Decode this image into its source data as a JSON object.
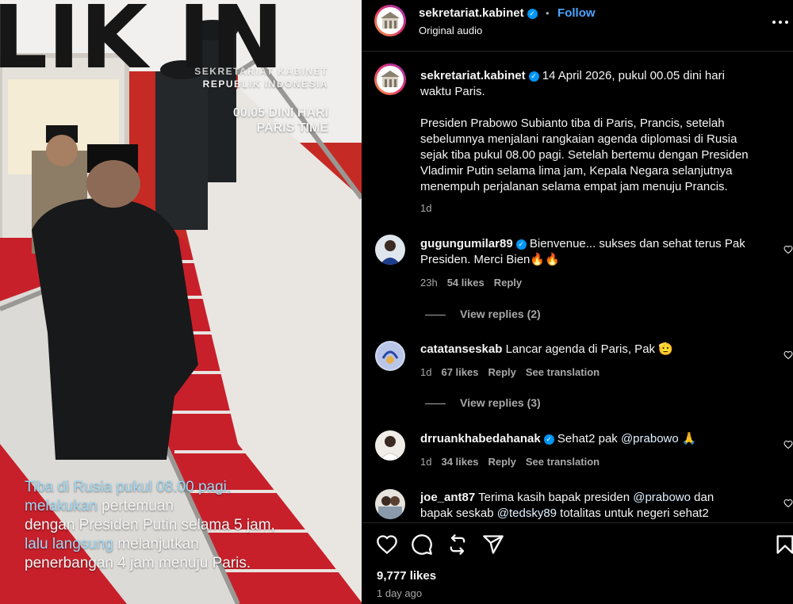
{
  "video": {
    "watermark_line1": "SEKRETARIAT KABINET",
    "watermark_line2": "REPUBLIK INDONESIA",
    "time_line1": "00.05 DINI HARI",
    "time_line2": "PARIS TIME",
    "caption": {
      "l1a": "Tiba di Rusia pukul 08.00 pagi,",
      "l2a": "melakukan",
      "l2b": " pertemuan",
      "l3": "dengan Presiden Putin selama 5 jam,",
      "l4a": "lalu langsung",
      "l4b": " melanjutkan",
      "l5": "penerbangan 4 jam menuju Paris."
    },
    "fuselage_text": "LIK IN"
  },
  "header": {
    "username": "sekretariat.kabinet",
    "separator": "•",
    "follow_label": "Follow",
    "audio": "Original audio",
    "more_icon": "more-horizontal-icon"
  },
  "post": {
    "username": "sekretariat.kabinet",
    "text_l1": "14 April 2026, pukul 00.05 dini hari",
    "text_l2": "waktu Paris.",
    "p2_l1": "Presiden Prabowo Subianto tiba di Paris, Prancis, setelah",
    "p2_l2": "sebelumnya menjalani rangkaian agenda diplomasi di Rusia",
    "p2_l3": "sejak tiba pukul 08.00 pagi. Setelah bertemu dengan Presiden",
    "p2_l4": "Vladimir Putin selama lima jam, Kepala Negara selanjutnya",
    "p2_l5": "menempuh perjalanan selama empat jam menuju Prancis.",
    "time": "1d"
  },
  "comments": [
    {
      "username": "gugungumilar89",
      "text_l1": "Bienvenue... sukses dan sehat terus Pak",
      "text_l2": "Presiden. Merci Bien🔥🔥",
      "time": "23h",
      "likes": "54 likes",
      "reply": "Reply",
      "view_replies": "View replies (2)"
    },
    {
      "username": "catatanseskab",
      "text_l1": "Lancar agenda di Paris, Pak 🫡",
      "time": "1d",
      "likes": "67 likes",
      "reply": "Reply",
      "translate": "See translation",
      "view_replies": "View replies (3)"
    },
    {
      "username": "drruankhabedahanak",
      "text_a": "Sehat2 pak ",
      "mention": "@prabowo",
      "text_b": " 🙏",
      "time": "1d",
      "likes": "34 likes",
      "reply": "Reply",
      "translate": "See translation"
    },
    {
      "username": "joe_ant87",
      "text_a": "Terima kasih bapak presiden ",
      "mention1": "@prabowo",
      "text_b": " dan",
      "text_c": "bapak seskab ",
      "mention2": "@tedsky89",
      "text_d": " totalitas untuk negeri sehat2"
    }
  ],
  "actions": {
    "icons": [
      "heart-icon",
      "comment-icon",
      "repost-icon",
      "share-icon",
      "bookmark-icon"
    ],
    "likes": "9,777 likes",
    "date": "1 day ago"
  }
}
